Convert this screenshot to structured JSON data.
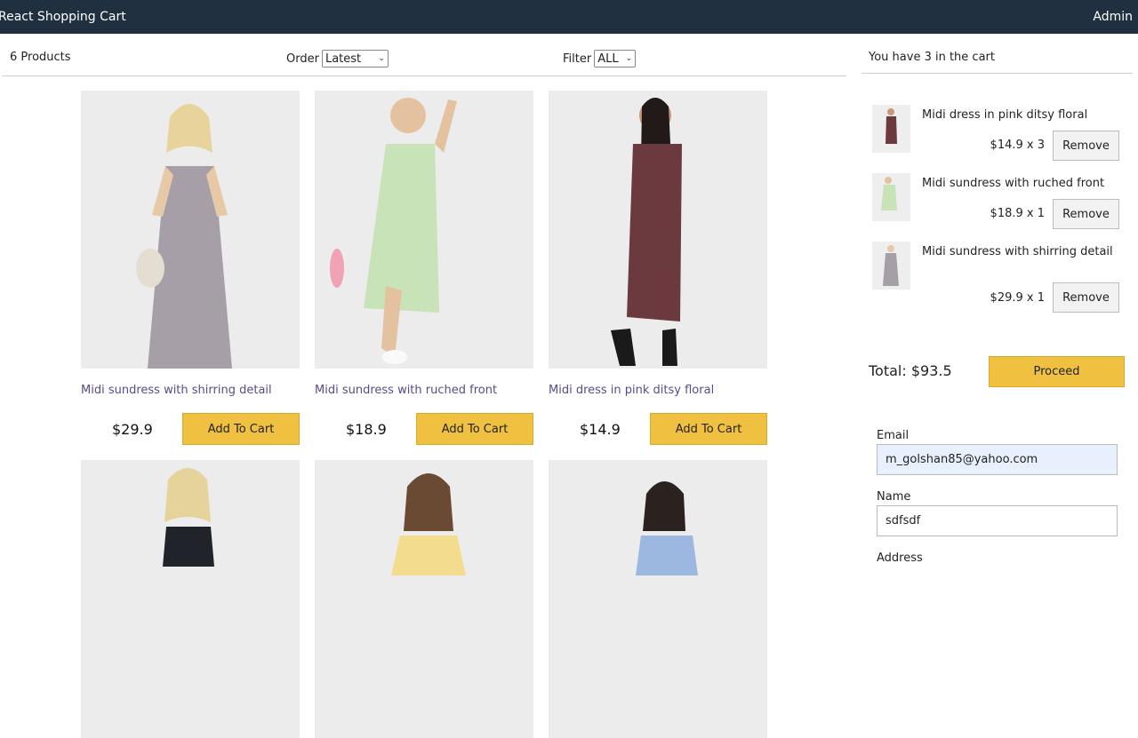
{
  "app": {
    "brand": "React Shopping Cart",
    "admin": "Admin"
  },
  "filter_bar": {
    "count_label": "6 Products",
    "order_label": "Order",
    "order_value": "Latest",
    "filter_label": "Filter",
    "filter_value": "ALL"
  },
  "products": [
    {
      "title": "Midi sundress with shirring detail",
      "price": "$29.9",
      "button": "Add To Cart"
    },
    {
      "title": "Midi sundress with ruched front",
      "price": "$18.9",
      "button": "Add To Cart"
    },
    {
      "title": "Midi dress in pink ditsy floral",
      "price": "$14.9",
      "button": "Add To Cart"
    },
    {
      "title": "",
      "price": "",
      "button": ""
    },
    {
      "title": "",
      "price": "",
      "button": ""
    },
    {
      "title": "",
      "price": "",
      "button": ""
    }
  ],
  "cart": {
    "header": "You have 3 in the cart",
    "items": [
      {
        "name": "Midi dress in pink ditsy floral",
        "qty": "$14.9 x 3",
        "remove": "Remove"
      },
      {
        "name": "Midi sundress with ruched front",
        "qty": "$18.9 x 1",
        "remove": "Remove"
      },
      {
        "name": "Midi sundress with shirring detail",
        "qty": "$29.9 x 1",
        "remove": "Remove"
      }
    ],
    "total": "Total: $93.5",
    "proceed": "Proceed"
  },
  "form": {
    "email_label": "Email",
    "email_value": "m_golshan85@yahoo.com",
    "name_label": "Name",
    "name_value": "sdfsdf",
    "address_label": "Address"
  },
  "colors": {
    "topbar": "#203040",
    "accent_button": "#f0c040",
    "product_title": "#5a4a8a"
  }
}
